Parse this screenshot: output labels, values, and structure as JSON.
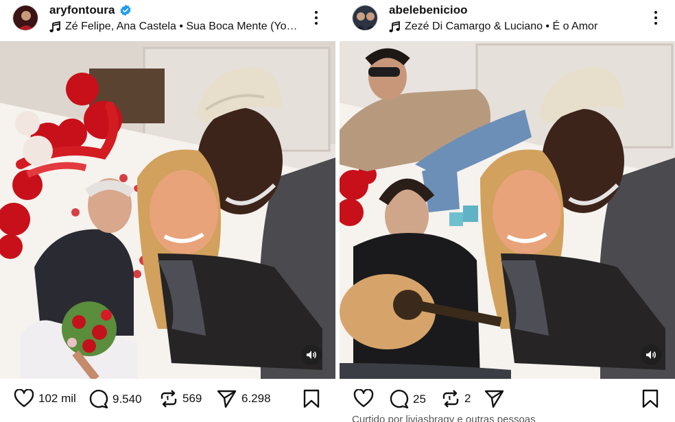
{
  "posts": [
    {
      "username": "aryfontoura",
      "verified": true,
      "music_text": "Zé Felipe, Ana Castela • Sua Boca Mente (Yo…",
      "likes": "102 mil",
      "comments": "9.540",
      "reposts": "569",
      "shares": "6.298",
      "icons": [
        "music-note-icon",
        "more-options-icon",
        "mute-icon",
        "heart-icon",
        "comment-icon",
        "repost-icon",
        "send-icon",
        "bookmark-icon"
      ]
    },
    {
      "username": "abelebenicioo",
      "verified": false,
      "music_text": "Zezé Di Camargo & Luciano • É o Amor",
      "likes": "",
      "comments": "25",
      "reposts": "2",
      "shares": "",
      "footer_partial": "Curtido por liviasbragy e outras pessoas",
      "icons": [
        "music-note-icon",
        "more-options-icon",
        "mute-icon",
        "heart-icon",
        "comment-icon",
        "repost-icon",
        "send-icon",
        "bookmark-icon"
      ]
    }
  ],
  "colors": {
    "verified_blue": "#1d9bf0",
    "text": "#111111",
    "balloon_red": "#d0121b",
    "wall": "#e9e5e1"
  }
}
